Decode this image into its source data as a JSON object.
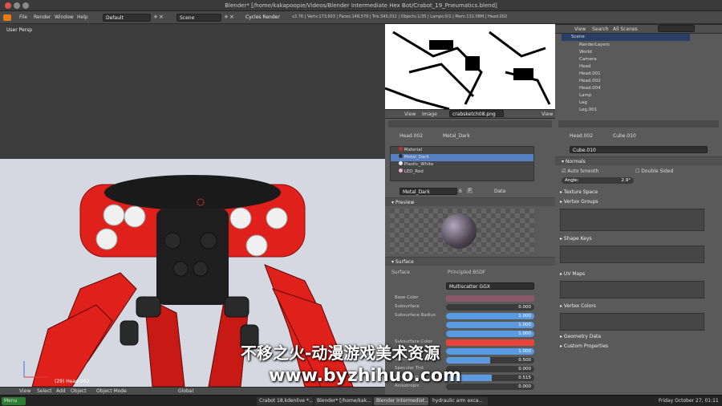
{
  "titlebar": {
    "title": "Blender* [/home/kakapoopie/Videos/Blender Intermediate Hex Bot/Crabot_19_Pneumatics.blend]"
  },
  "menubar": {
    "menus": [
      "File",
      "Render",
      "Window",
      "Help"
    ],
    "layout": "Default",
    "scene": "Scene",
    "engine": "Cycles Render",
    "stats": "v2.76 | Verts:173,603 | Faces:148,579 | Tris:345,032 | Objects:1/35 | Lamps:0/1 | Mem:132.08M | Head.002"
  },
  "viewport": {
    "label": "User Persp",
    "object_label": "(29) Head.002",
    "header_items": [
      "View",
      "Select",
      "Add",
      "Object",
      "Object Mode",
      "Global"
    ]
  },
  "image_editor": {
    "header_items": [
      "View",
      "Image"
    ],
    "image_name": "crabsketch08.png",
    "view_label": "View"
  },
  "material_panel": {
    "breadcrumb": [
      "Head.002",
      "Metal_Dark"
    ],
    "slots": [
      "Material",
      "Metal_Dark",
      "Plastic_White",
      "LED_Red"
    ],
    "selected_slot": "Metal_Dark",
    "material_name": "Metal_Dark",
    "material_users": "6",
    "material_f": "F",
    "data_label": "Data",
    "preview_title": "Preview",
    "surface_title": "Surface",
    "surface_label": "Surface",
    "shader": "Principled BSDF",
    "distribution": "Multiscatter GGX",
    "params": [
      {
        "label": "Base Color",
        "kind": "color",
        "color": "#8a5a6a"
      },
      {
        "label": "Subsurface",
        "kind": "value",
        "value": "0.000",
        "fill": 0.0
      },
      {
        "label": "Subsurface Radius",
        "kind": "value",
        "value": "1.000",
        "fill": 1.0
      },
      {
        "label": "",
        "kind": "value",
        "value": "1.000",
        "fill": 1.0
      },
      {
        "label": "",
        "kind": "value",
        "value": "1.000",
        "fill": 1.0
      },
      {
        "label": "Subsurface Color",
        "kind": "color",
        "color": "#e8443a"
      },
      {
        "label": "Metallic",
        "kind": "value",
        "value": "1.000",
        "fill": 1.0
      },
      {
        "label": "Specular",
        "kind": "value",
        "value": "0.500",
        "fill": 0.5
      },
      {
        "label": "Specular Tint",
        "kind": "value",
        "value": "0.000",
        "fill": 0.0
      },
      {
        "label": "Roughness",
        "kind": "value",
        "value": "0.515",
        "fill": 0.515
      },
      {
        "label": "Anisotropic",
        "kind": "value",
        "value": "0.000",
        "fill": 0.0
      }
    ]
  },
  "outliner": {
    "header_items": [
      "View",
      "Search",
      "All Scenes"
    ],
    "scene": "Scene",
    "items": [
      "RenderLayers",
      "World",
      "Camera",
      "Head",
      "Head.001",
      "Head.002",
      "Head.004",
      "Lamp",
      "Leg",
      "Leg.001"
    ]
  },
  "mesh_panel": {
    "breadcrumb": [
      "Head.002",
      "Cube.010"
    ],
    "mesh_name": "Cube.010",
    "normals_title": "Normals",
    "auto_smooth": "Auto Smooth",
    "double_sided": "Double Sided",
    "angle_label": "Angle:",
    "angle_value": "2.9°",
    "sections": [
      "Texture Space",
      "Vertex Groups",
      "Shape Keys",
      "UV Maps",
      "Vertex Colors",
      "Geometry Data",
      "Custom Properties"
    ]
  },
  "taskbar": {
    "menu": "Menu",
    "windows": [
      "Crabot 18.kdenlive *...",
      "Blender* [/home/kak...",
      "Blender Intermediat...",
      "hydraulic arm exca..."
    ],
    "clock": "Friday October 27, 01:11"
  },
  "watermark": {
    "line1": "不移之火-动漫游戏美术资源",
    "line2": "www.byzhihuo.com"
  }
}
